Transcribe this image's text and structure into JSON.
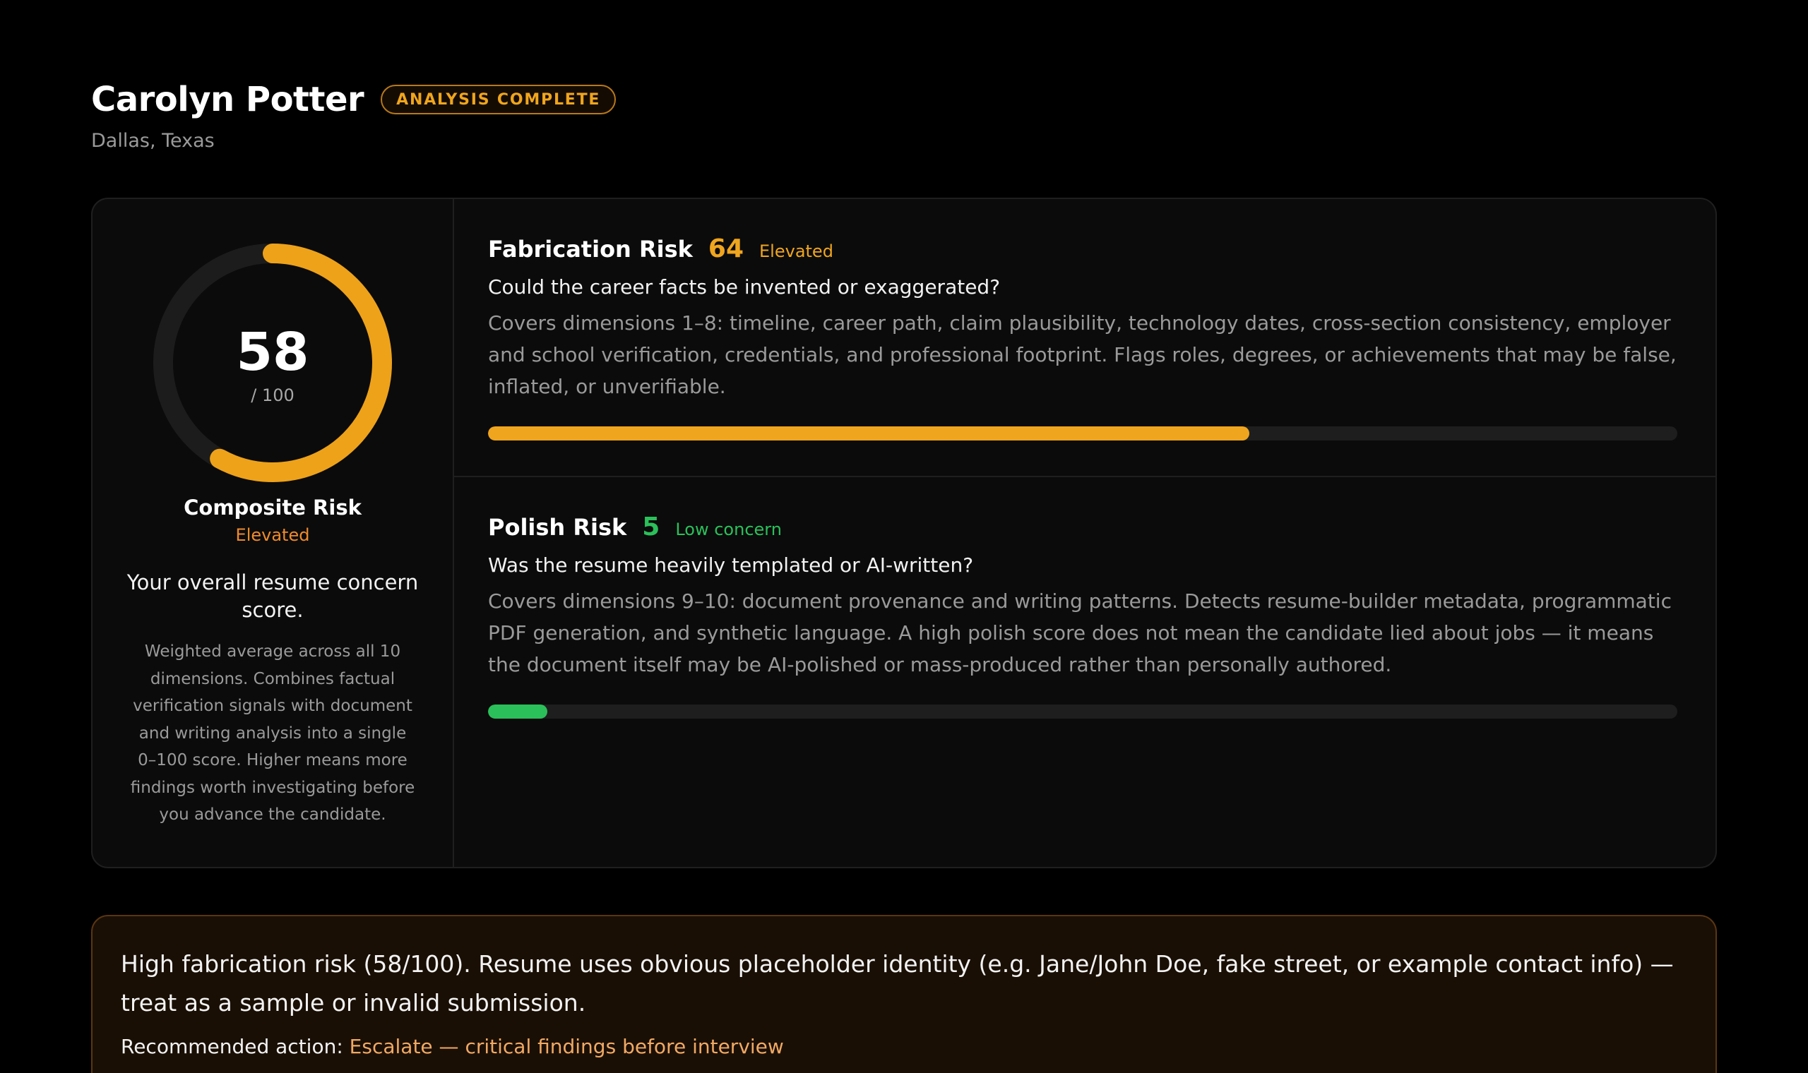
{
  "candidate": {
    "name": "Carolyn Potter",
    "status": "ANALYSIS COMPLETE",
    "location": "Dallas, Texas"
  },
  "composite": {
    "score": 58,
    "max_label": "/ 100",
    "label": "Composite Risk",
    "level": "Elevated",
    "headline": "Your overall resume concern score.",
    "description": "Weighted average across all 10 dimensions. Combines factual verification signals with document and writing analysis into a single 0–100 score. Higher means more findings worth investigating before you advance the candidate.",
    "color": "#eea21a"
  },
  "fabrication": {
    "title": "Fabrication Risk",
    "score": 64,
    "score_text": "64",
    "level": "Elevated",
    "question": "Could the career facts be invented or exaggerated?",
    "description": "Covers dimensions 1–8: timeline, career path, claim plausibility, technology dates, cross-section consistency, employer and school verification, credentials, and professional footprint. Flags roles, degrees, or achievements that may be false, inflated, or unverifiable.",
    "fill_percent": 64,
    "color": "#f0a51e"
  },
  "polish": {
    "title": "Polish Risk",
    "score": 5,
    "score_text": "5",
    "level": "Low concern",
    "question": "Was the resume heavily templated or AI-written?",
    "description": "Covers dimensions 9–10: document provenance and writing patterns. Detects resume-builder metadata, programmatic PDF generation, and synthetic language. A high polish score does not mean the candidate lied about jobs — it means the document itself may be AI-polished or mass-produced rather than personally authored.",
    "fill_percent": 5,
    "color": "#2bc05a"
  },
  "alert": {
    "message": "High fabrication risk (58/100). Resume uses obvious placeholder identity (e.g. Jane/John Doe, fake street, or example contact info) — treat as a sample or invalid submission.",
    "action_label": "Recommended action: ",
    "action_value": "Escalate — critical findings before interview"
  }
}
